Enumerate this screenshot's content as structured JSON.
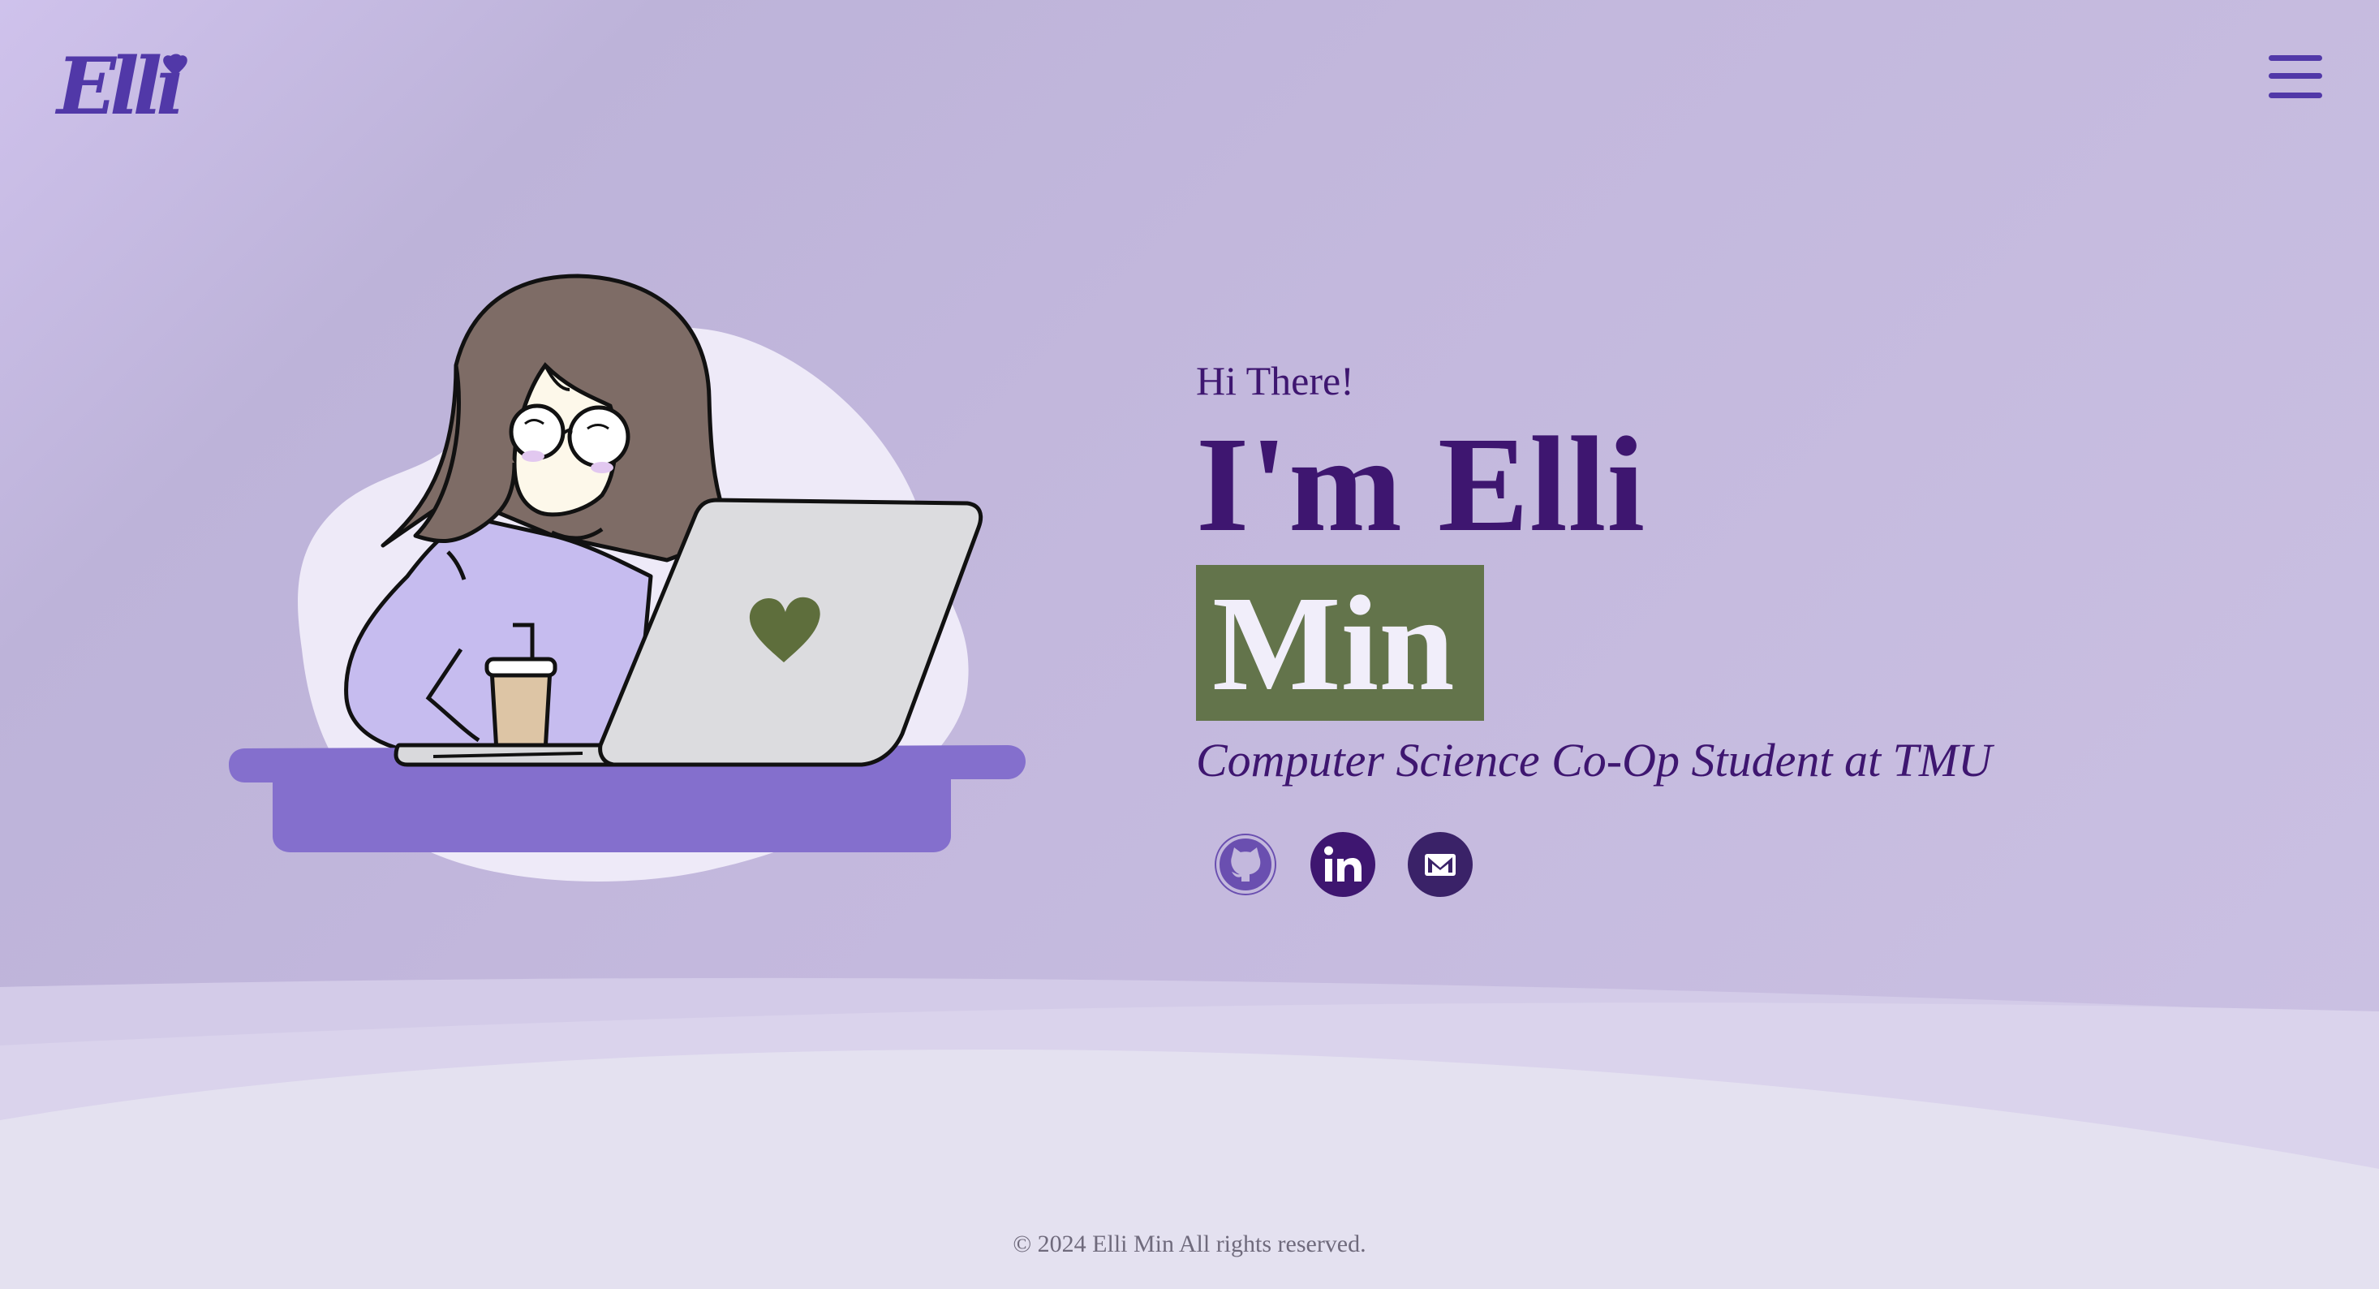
{
  "header": {
    "logo_text": "Elli",
    "menu_icon": "hamburger-menu-icon"
  },
  "hero": {
    "greeting": "Hi There!",
    "name_line": "I'm Elli",
    "surname": "Min",
    "subtitle": "Computer Science Co-Op Student at TMU",
    "illustration": "girl-with-laptop-illustration"
  },
  "socials": [
    {
      "name": "github",
      "icon": "github-icon"
    },
    {
      "name": "linkedin",
      "icon": "linkedin-icon"
    },
    {
      "name": "email",
      "icon": "mail-icon"
    }
  ],
  "footer": {
    "copyright": "© 2024 Elli Min All rights reserved."
  },
  "colors": {
    "primary": "#3e1670",
    "accent": "#5138a8",
    "highlight": "#63744b",
    "desk": "#846fcd"
  }
}
